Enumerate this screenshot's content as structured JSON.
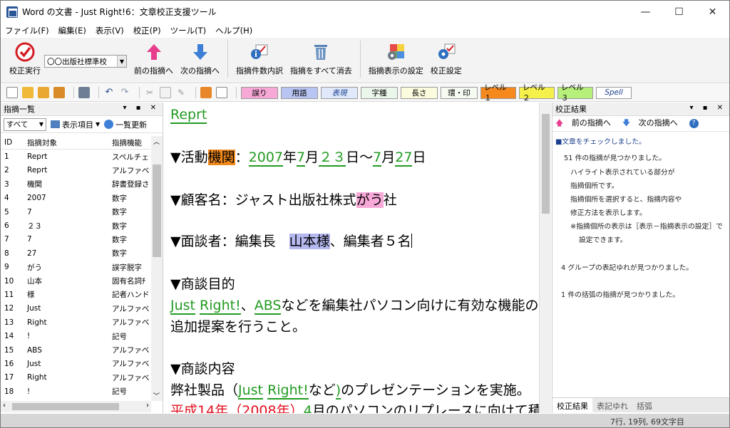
{
  "window": {
    "title": "Word の文書 - Just Right!6：文章校正支援ツール"
  },
  "menu": [
    "ファイル(F)",
    "編集(E)",
    "表示(V)",
    "校正(P)",
    "ツール(T)",
    "ヘルプ(H)"
  ],
  "toolbar": {
    "check": "校正実行",
    "standard": "〇〇出版社標準校",
    "prev": "前の指摘へ",
    "next": "次の指摘へ",
    "count": "指摘件数内訳",
    "clear": "指摘をすべて消去",
    "display_setting": "指摘表示の設定",
    "settings": "校正設定"
  },
  "categories": [
    {
      "label": "誤り",
      "bg": "#f7a8d6"
    },
    {
      "label": "用語",
      "bg": "#b8c4f2"
    },
    {
      "label": "表現",
      "bg": "#dfe9fb"
    },
    {
      "label": "字種",
      "bg": "#e9f6e9"
    },
    {
      "label": "長さ",
      "bg": "#fbfbdd"
    },
    {
      "label": "環・印",
      "bg": "#f5fbf0"
    },
    {
      "label": "レベル１",
      "bg": "#f5891e"
    },
    {
      "label": "レベル２",
      "bg": "#f6f14a"
    },
    {
      "label": "レベル３",
      "bg": "#b6f07a"
    },
    {
      "label": "Spell",
      "bg": "#ffffff"
    }
  ],
  "left_panel": {
    "title": "指摘一覧",
    "filter": "すべて",
    "display_items": "表示項目",
    "refresh": "一覧更新",
    "columns": [
      "ID",
      "指摘対象",
      "指摘機能"
    ],
    "rows": [
      [
        "1",
        "Reprt",
        "スペルチェッ"
      ],
      [
        "2",
        "Reprt",
        "アルファベッ"
      ],
      [
        "3",
        "機関",
        "辞書登録さ"
      ],
      [
        "4",
        "2007",
        "数字"
      ],
      [
        "5",
        "7",
        "数字"
      ],
      [
        "6",
        "２３",
        "数字"
      ],
      [
        "7",
        "7",
        "数字"
      ],
      [
        "8",
        "27",
        "数字"
      ],
      [
        "9",
        "がう",
        "誤字脱字"
      ],
      [
        "10",
        "山本",
        "固有名詞ﾁ"
      ],
      [
        "11",
        "様",
        "記者ハンド"
      ],
      [
        "12",
        "Just",
        "アルファベッ"
      ],
      [
        "13",
        "Right",
        "アルファベッ"
      ],
      [
        "14",
        "!",
        "記号"
      ],
      [
        "15",
        "ABS",
        "アルファベッ"
      ],
      [
        "16",
        "Just",
        "アルファベッ"
      ],
      [
        "17",
        "Right",
        "アルファベッ"
      ],
      [
        "18",
        "!",
        "記号"
      ]
    ]
  },
  "editor": {
    "l1": "Reprt",
    "l2a": "▼活動",
    "l2b": "機関",
    "l2c": "：",
    "l2d": "2007",
    "l2e": "年",
    "l2f": "7",
    "l2g": "月",
    "l2h": "２３",
    "l2i": "日～",
    "l2j": "7",
    "l2k": "月",
    "l2l": "27",
    "l2m": "日",
    "l3a": "▼顧客名：ジャスト出版社株式",
    "l3b": "がう",
    "l3c": "社",
    "l4a": "▼面談者：編集長　",
    "l4b": "山本様",
    "l4c": "、編集者５名",
    "l5": "▼商談目的",
    "l6a": "Just",
    "l6b": " ",
    "l6c": "Right!",
    "l6d": "、",
    "l6e": "ABS",
    "l6f": "などを編集社パソコン向けに有効な機能の",
    "l7": "追加提案を行うこと。",
    "l8": "▼商談内容",
    "l9a": "弊社製品（",
    "l9b": "Just",
    "l9c": " ",
    "l9d": "Right!",
    "l9e": "など",
    "l9f": ")",
    "l9g": "のプレゼンテーションを実施。",
    "l10a": "平成",
    "l10b": "14",
    "l10c": "年",
    "l10d": "（",
    "l10e": "2008",
    "l10f": "年",
    "l10g": "）",
    "l10h": "4",
    "l10i": "月のパソコンのリプレースに向けて積"
  },
  "right_panel": {
    "title": "校正結果",
    "prev": "前の指摘へ",
    "next": "次の指摘へ",
    "lines": [
      "■文章をチェックしました。",
      "51 件の指摘が見つかりました。",
      "ハイライト表示されている部分が",
      "指摘個所です。",
      "指摘個所を選択すると、指摘内容や",
      "修正方法を表示します。",
      "※指摘個所の表示は［表示－指摘表示の設定］で",
      "設定できます。",
      "4 グループの表記ゆれが見つかりました。",
      "1 件の括弧の指摘が見つかりました。"
    ],
    "tabs": [
      "校正結果",
      "表記ゆれ",
      "括弧"
    ]
  },
  "status": {
    "position": "7行, 19列, 69文字目"
  }
}
